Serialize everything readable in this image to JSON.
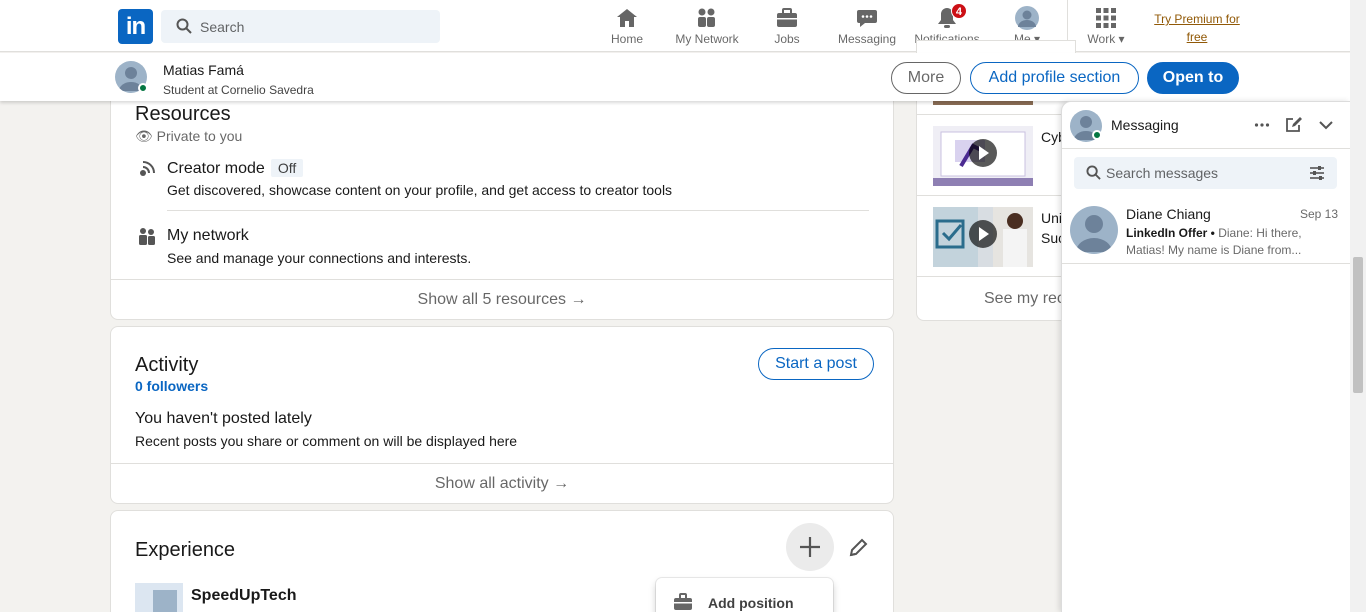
{
  "nav": {
    "logo_text": "in",
    "search_placeholder": "Search",
    "items": [
      {
        "label": "Home",
        "icon": "home-icon"
      },
      {
        "label": "My Network",
        "icon": "network-icon"
      },
      {
        "label": "Jobs",
        "icon": "briefcase-icon"
      },
      {
        "label": "Messaging",
        "icon": "messaging-icon"
      },
      {
        "label": "Notifications",
        "icon": "bell-icon",
        "badge": "4"
      },
      {
        "label": "Me",
        "icon": "avatar-icon"
      },
      {
        "label": "Work",
        "icon": "grid-icon"
      }
    ],
    "premium_line1": "Try Premium for",
    "premium_line2": "free"
  },
  "profile_bar": {
    "name": "Matias Famá",
    "headline": "Student at Cornelio Savedra",
    "more_label": "More",
    "add_section_label": "Add profile section",
    "open_to_label": "Open to"
  },
  "resources": {
    "title": "Resources",
    "privacy": "Private to you",
    "creator_title": "Creator mode",
    "creator_state": "Off",
    "creator_desc": "Get discovered, showcase content on your profile, and get access to creator tools",
    "network_title": "My network",
    "network_desc": "See and manage your connections and interests.",
    "show_all": "Show all 5 resources →"
  },
  "activity": {
    "title": "Activity",
    "followers": "0 followers",
    "start_post": "Start a post",
    "empty_title": "You haven't posted lately",
    "empty_desc": "Recent posts you share or comment on will be displayed here",
    "show_all": "Show all activity →"
  },
  "experience": {
    "title": "Experience",
    "company": "SpeedUpTech",
    "add_position": "Add position"
  },
  "learning": {
    "course2_text": "Cyb",
    "course3_line1": "Uni",
    "course3_line2": "Suc",
    "see_more": "See my rec"
  },
  "messaging": {
    "title": "Messaging",
    "search_placeholder": "Search messages",
    "conversation": {
      "name": "Diane Chiang",
      "date": "Sep 13",
      "tag": "LinkedIn Offer •",
      "preview_start": "Diane: Hi there,",
      "preview_rest": "Matias! My name is Diane from..."
    }
  },
  "colors": {
    "brand_blue": "#0a66c2",
    "badge_red": "#cc1016",
    "online_green": "#057642",
    "premium_gold": "#915907"
  }
}
